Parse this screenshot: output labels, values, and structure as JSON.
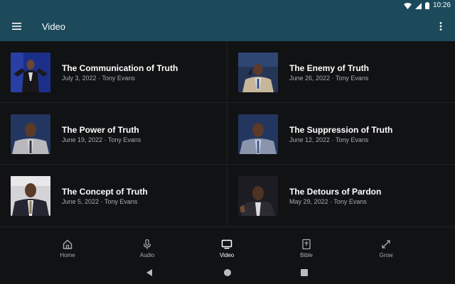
{
  "status": {
    "time": "10:26"
  },
  "app_bar": {
    "title": "Video"
  },
  "videos": [
    {
      "title": "The Communication of Truth",
      "meta": "July 3, 2022 · Tony Evans"
    },
    {
      "title": "The Enemy of Truth",
      "meta": "June 26, 2022 · Tony Evans"
    },
    {
      "title": "The Power of Truth",
      "meta": "June 19, 2022 · Tony Evans"
    },
    {
      "title": "The Suppression of Truth",
      "meta": "June 12, 2022 · Tony Evans"
    },
    {
      "title": "The Concept of Truth",
      "meta": "June 5, 2022 · Tony Evans"
    },
    {
      "title": "The Detours of Pardon",
      "meta": "May 29, 2022 · Tony Evans"
    }
  ],
  "bottom_nav": [
    {
      "label": "Home",
      "icon": "home-icon"
    },
    {
      "label": "Audio",
      "icon": "microphone-icon"
    },
    {
      "label": "Video",
      "icon": "tv-icon",
      "active": true
    },
    {
      "label": "Bible",
      "icon": "bible-icon"
    },
    {
      "label": "Grow",
      "icon": "grow-icon"
    }
  ],
  "colors": {
    "app_bar": "#1c4a5a",
    "background": "#111214",
    "meta_text": "#a7abb0"
  }
}
